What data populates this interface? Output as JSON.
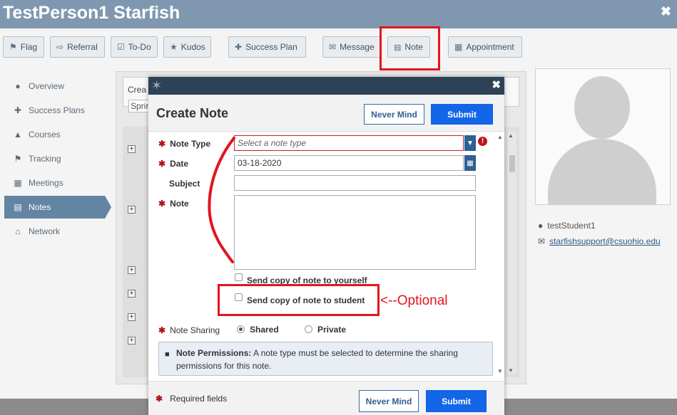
{
  "window": {
    "title": "TestPerson1 Starfish",
    "close_glyph": "✖"
  },
  "toolbar": [
    {
      "label": "Flag",
      "icon": "flag-icon",
      "glyph": "⚑"
    },
    {
      "label": "Referral",
      "icon": "referral-icon",
      "glyph": "⇨"
    },
    {
      "label": "To-Do",
      "icon": "todo-icon",
      "glyph": "☑"
    },
    {
      "label": "Kudos",
      "icon": "star-icon",
      "glyph": "★"
    },
    {
      "label": "Success Plan",
      "icon": "success-plan-icon",
      "glyph": "✚"
    },
    {
      "label": "Message",
      "icon": "envelope-icon",
      "glyph": "✉"
    },
    {
      "label": "Note",
      "icon": "note-icon",
      "glyph": "📄"
    },
    {
      "label": "Appointment",
      "icon": "calendar-icon",
      "glyph": "▦"
    }
  ],
  "sidebar": {
    "items": [
      {
        "label": "Overview",
        "icon": "person-icon",
        "glyph": "👤",
        "active": false
      },
      {
        "label": "Success Plans",
        "icon": "success-plan-icon",
        "glyph": "✚",
        "active": false
      },
      {
        "label": "Courses",
        "icon": "graduation-cap-icon",
        "glyph": "🎓",
        "active": false
      },
      {
        "label": "Tracking",
        "icon": "flag-icon",
        "glyph": "⚑",
        "active": false
      },
      {
        "label": "Meetings",
        "icon": "calendar-icon",
        "glyph": "▦",
        "active": false
      },
      {
        "label": "Notes",
        "icon": "note-icon",
        "glyph": "📄",
        "active": true
      },
      {
        "label": "Network",
        "icon": "institution-icon",
        "glyph": "🏛",
        "active": false
      }
    ]
  },
  "background_panel": {
    "partial_label": "Crea",
    "partial_select": "Sprir"
  },
  "student": {
    "name": "testStudent1",
    "email": "starfishsupport@csuohio.edu"
  },
  "modal": {
    "title": "Create Note",
    "never_mind_label": "Never Mind",
    "submit_label": "Submit",
    "close_glyph": "✖",
    "fields": {
      "note_type": {
        "label": "Note Type",
        "placeholder": "Select a note type",
        "value": ""
      },
      "date": {
        "label": "Date",
        "value": "03-18-2020"
      },
      "subject": {
        "label": "Subject",
        "value": ""
      },
      "note": {
        "label": "Note",
        "value": ""
      }
    },
    "copy_to_self": {
      "label": "Send copy of note to yourself",
      "checked": false
    },
    "copy_to_student": {
      "label": "Send copy of note to student",
      "checked": false
    },
    "sharing": {
      "label": "Note Sharing",
      "options": [
        {
          "label": "Shared",
          "selected": true
        },
        {
          "label": "Private",
          "selected": false
        }
      ]
    },
    "permissions": {
      "title": "Note Permissions:",
      "text": "A note type must be selected to determine the sharing permissions for this note."
    },
    "required_note": "Required fields",
    "required_marker": "✱"
  },
  "annotation": {
    "optional_label": "<--Optional",
    "color": "#e3141d"
  },
  "colors": {
    "header": "#7f98b0",
    "modal_bar": "#2e4257",
    "submit": "#1466e8",
    "active_nav": "#6384a3",
    "required": "#b5121b"
  }
}
